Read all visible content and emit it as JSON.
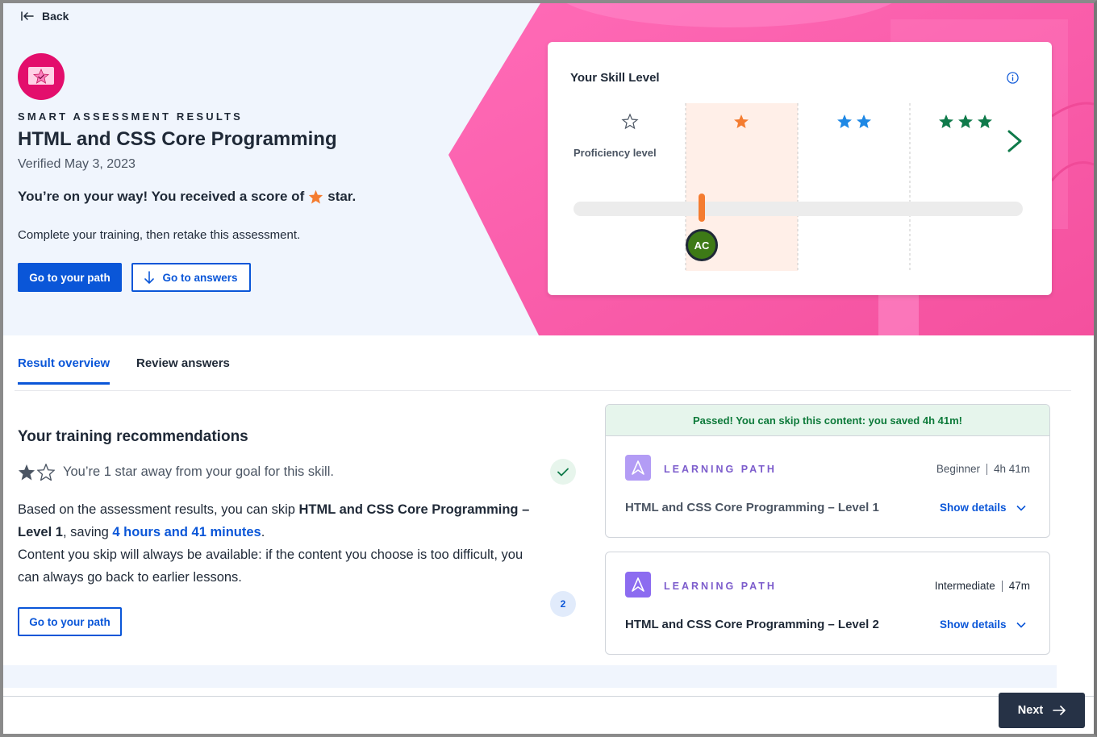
{
  "header": {
    "back_label": "Back",
    "kicker": "SMART ASSESSMENT RESULTS",
    "title": "HTML and CSS Core Programming",
    "verified": "Verified May 3, 2023",
    "score_text_before": "You’re on your way! You received a score of",
    "score_text_after": "star.",
    "subtext": "Complete your training, then retake this assessment.",
    "primary_button": "Go to your path",
    "secondary_button": "Go to answers"
  },
  "skill_card": {
    "title": "Your Skill Level",
    "proficiency_label": "Proficiency level",
    "avatar_initials": "AC",
    "level_stars": [
      0,
      1,
      2,
      3
    ],
    "current_level": 1
  },
  "tabs": [
    {
      "label": "Result overview",
      "active": true
    },
    {
      "label": "Review answers",
      "active": false
    }
  ],
  "recommendations": {
    "title": "Your training recommendations",
    "goal_text": "You’re 1 star away from your goal for this skill.",
    "stars_filled": 1,
    "stars_total": 2,
    "body_1": "Based on the assessment results, you can skip ",
    "body_bold": "HTML and CSS Core Programming – Level 1",
    "body_2": ", saving ",
    "body_link": "4 hours and 41 minutes",
    "body_3": ".",
    "body_4": "Content you skip will always be available: if the content you choose is too difficult, you can always go back to earlier lessons.",
    "button": "Go to your path",
    "step_two": "2"
  },
  "paths": [
    {
      "banner": "Passed! You can skip this content: you saved 4h 41m!",
      "type": "LEARNING PATH",
      "level": "Beginner",
      "duration": "4h 41m",
      "name": "HTML and CSS Core Programming – Level 1",
      "details": "Show details"
    },
    {
      "type": "LEARNING PATH",
      "level": "Intermediate",
      "duration": "47m",
      "name": "HTML and CSS Core Programming – Level 2",
      "details": "Show details"
    }
  ],
  "footer": {
    "next_label": "Next"
  },
  "colors": {
    "accent": "#0a56d8",
    "pink": "#ff5fb0",
    "star_orange": "#f47c30",
    "star_blue": "#1e88e5",
    "star_green": "#0f7a4a",
    "next_bg": "#263246"
  }
}
